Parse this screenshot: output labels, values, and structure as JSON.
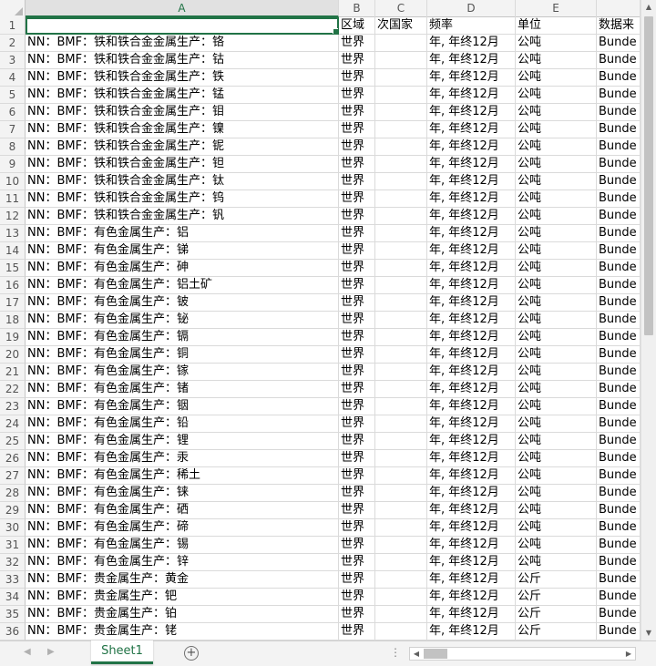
{
  "columns": [
    "A",
    "B",
    "C",
    "D",
    "E",
    ""
  ],
  "header_row": {
    "num": "1",
    "a": "",
    "b": "区域",
    "c": "次国家",
    "d": "频率",
    "e": "单位",
    "f": "数据来"
  },
  "rows": [
    {
      "num": "2",
      "a": "NN：BMF：铁和铁合金金属生产：铬",
      "b": "世界",
      "c": "",
      "d": "年, 年终12月",
      "e": "公吨",
      "f": "Bunde"
    },
    {
      "num": "3",
      "a": "NN：BMF：铁和铁合金金属生产：钴",
      "b": "世界",
      "c": "",
      "d": "年, 年终12月",
      "e": "公吨",
      "f": "Bunde"
    },
    {
      "num": "4",
      "a": "NN：BMF：铁和铁合金金属生产：铁",
      "b": "世界",
      "c": "",
      "d": "年, 年终12月",
      "e": "公吨",
      "f": "Bunde"
    },
    {
      "num": "5",
      "a": "NN：BMF：铁和铁合金金属生产：锰",
      "b": "世界",
      "c": "",
      "d": "年, 年终12月",
      "e": "公吨",
      "f": "Bunde"
    },
    {
      "num": "6",
      "a": "NN：BMF：铁和铁合金金属生产：钼",
      "b": "世界",
      "c": "",
      "d": "年, 年终12月",
      "e": "公吨",
      "f": "Bunde"
    },
    {
      "num": "7",
      "a": "NN：BMF：铁和铁合金金属生产：镍",
      "b": "世界",
      "c": "",
      "d": "年, 年终12月",
      "e": "公吨",
      "f": "Bunde"
    },
    {
      "num": "8",
      "a": "NN：BMF：铁和铁合金金属生产：铌",
      "b": "世界",
      "c": "",
      "d": "年, 年终12月",
      "e": "公吨",
      "f": "Bunde"
    },
    {
      "num": "9",
      "a": "NN：BMF：铁和铁合金金属生产：钽",
      "b": "世界",
      "c": "",
      "d": "年, 年终12月",
      "e": "公吨",
      "f": "Bunde"
    },
    {
      "num": "10",
      "a": "NN：BMF：铁和铁合金金属生产：钛",
      "b": "世界",
      "c": "",
      "d": "年, 年终12月",
      "e": "公吨",
      "f": "Bunde"
    },
    {
      "num": "11",
      "a": "NN：BMF：铁和铁合金金属生产：钨",
      "b": "世界",
      "c": "",
      "d": "年, 年终12月",
      "e": "公吨",
      "f": "Bunde"
    },
    {
      "num": "12",
      "a": "NN：BMF：铁和铁合金金属生产：钒",
      "b": "世界",
      "c": "",
      "d": "年, 年终12月",
      "e": "公吨",
      "f": "Bunde"
    },
    {
      "num": "13",
      "a": "NN：BMF：有色金属生产：铝",
      "b": "世界",
      "c": "",
      "d": "年, 年终12月",
      "e": "公吨",
      "f": "Bunde"
    },
    {
      "num": "14",
      "a": "NN：BMF：有色金属生产：锑",
      "b": "世界",
      "c": "",
      "d": "年, 年终12月",
      "e": "公吨",
      "f": "Bunde"
    },
    {
      "num": "15",
      "a": "NN：BMF：有色金属生产：砷",
      "b": "世界",
      "c": "",
      "d": "年, 年终12月",
      "e": "公吨",
      "f": "Bunde"
    },
    {
      "num": "16",
      "a": "NN：BMF：有色金属生产：铝土矿",
      "b": "世界",
      "c": "",
      "d": "年, 年终12月",
      "e": "公吨",
      "f": "Bunde"
    },
    {
      "num": "17",
      "a": "NN：BMF：有色金属生产：铍",
      "b": "世界",
      "c": "",
      "d": "年, 年终12月",
      "e": "公吨",
      "f": "Bunde"
    },
    {
      "num": "18",
      "a": "NN：BMF：有色金属生产：铋",
      "b": "世界",
      "c": "",
      "d": "年, 年终12月",
      "e": "公吨",
      "f": "Bunde"
    },
    {
      "num": "19",
      "a": "NN：BMF：有色金属生产：镉",
      "b": "世界",
      "c": "",
      "d": "年, 年终12月",
      "e": "公吨",
      "f": "Bunde"
    },
    {
      "num": "20",
      "a": "NN：BMF：有色金属生产：铜",
      "b": "世界",
      "c": "",
      "d": "年, 年终12月",
      "e": "公吨",
      "f": "Bunde"
    },
    {
      "num": "21",
      "a": "NN：BMF：有色金属生产：镓",
      "b": "世界",
      "c": "",
      "d": "年, 年终12月",
      "e": "公吨",
      "f": "Bunde"
    },
    {
      "num": "22",
      "a": "NN：BMF：有色金属生产：锗",
      "b": "世界",
      "c": "",
      "d": "年, 年终12月",
      "e": "公吨",
      "f": "Bunde"
    },
    {
      "num": "23",
      "a": "NN：BMF：有色金属生产：铟",
      "b": "世界",
      "c": "",
      "d": "年, 年终12月",
      "e": "公吨",
      "f": "Bunde"
    },
    {
      "num": "24",
      "a": "NN：BMF：有色金属生产：铅",
      "b": "世界",
      "c": "",
      "d": "年, 年终12月",
      "e": "公吨",
      "f": "Bunde"
    },
    {
      "num": "25",
      "a": "NN：BMF：有色金属生产：锂",
      "b": "世界",
      "c": "",
      "d": "年, 年终12月",
      "e": "公吨",
      "f": "Bunde"
    },
    {
      "num": "26",
      "a": "NN：BMF：有色金属生产：汞",
      "b": "世界",
      "c": "",
      "d": "年, 年终12月",
      "e": "公吨",
      "f": "Bunde"
    },
    {
      "num": "27",
      "a": "NN：BMF：有色金属生产：稀土",
      "b": "世界",
      "c": "",
      "d": "年, 年终12月",
      "e": "公吨",
      "f": "Bunde"
    },
    {
      "num": "28",
      "a": "NN：BMF：有色金属生产：铼",
      "b": "世界",
      "c": "",
      "d": "年, 年终12月",
      "e": "公吨",
      "f": "Bunde"
    },
    {
      "num": "29",
      "a": "NN：BMF：有色金属生产：硒",
      "b": "世界",
      "c": "",
      "d": "年, 年终12月",
      "e": "公吨",
      "f": "Bunde"
    },
    {
      "num": "30",
      "a": "NN：BMF：有色金属生产：碲",
      "b": "世界",
      "c": "",
      "d": "年, 年终12月",
      "e": "公吨",
      "f": "Bunde"
    },
    {
      "num": "31",
      "a": "NN：BMF：有色金属生产：锡",
      "b": "世界",
      "c": "",
      "d": "年, 年终12月",
      "e": "公吨",
      "f": "Bunde"
    },
    {
      "num": "32",
      "a": "NN：BMF：有色金属生产：锌",
      "b": "世界",
      "c": "",
      "d": "年, 年终12月",
      "e": "公吨",
      "f": "Bunde"
    },
    {
      "num": "33",
      "a": "NN：BMF：贵金属生产：黄金",
      "b": "世界",
      "c": "",
      "d": "年, 年终12月",
      "e": "公斤",
      "f": "Bunde"
    },
    {
      "num": "34",
      "a": "NN：BMF：贵金属生产：钯",
      "b": "世界",
      "c": "",
      "d": "年, 年终12月",
      "e": "公斤",
      "f": "Bunde"
    },
    {
      "num": "35",
      "a": "NN：BMF：贵金属生产：铂",
      "b": "世界",
      "c": "",
      "d": "年, 年终12月",
      "e": "公斤",
      "f": "Bunde"
    },
    {
      "num": "36",
      "a": "NN：BMF：贵金属生产：铑",
      "b": "世界",
      "c": "",
      "d": "年, 年终12月",
      "e": "公斤",
      "f": "Bunde"
    }
  ],
  "sheet_tab": "Sheet1",
  "add_sheet": "+",
  "colors": {
    "accent": "#217346",
    "header_bg": "#f3f3f3",
    "gridline": "#dadada"
  }
}
